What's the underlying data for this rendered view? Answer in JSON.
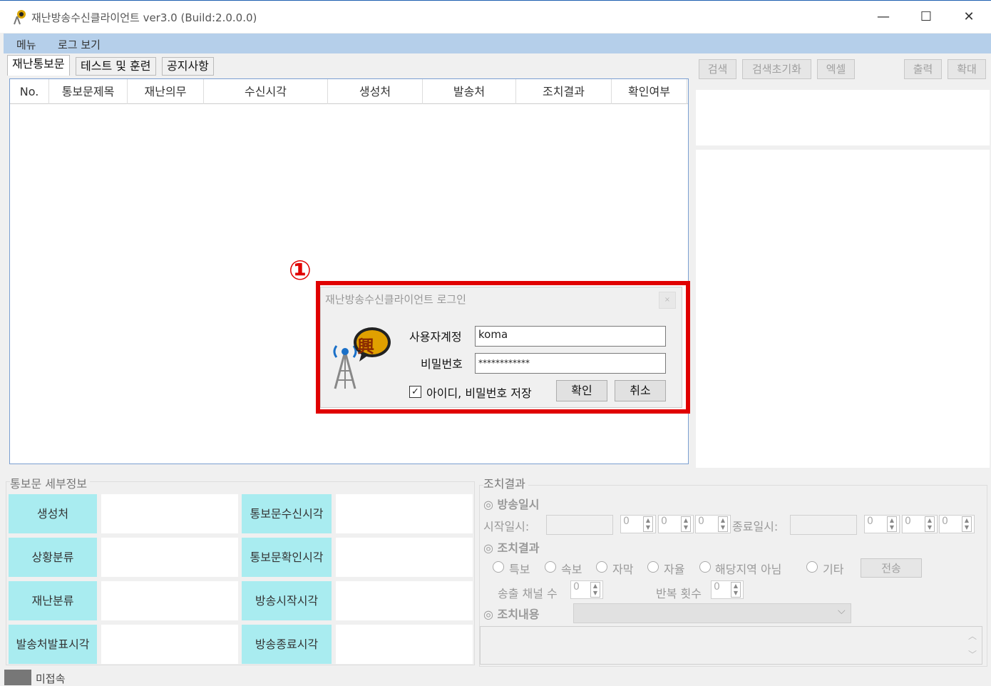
{
  "window": {
    "title": "재난방송수신클라이언트 ver3.0 (Build:2.0.0.0)",
    "minimize": "—",
    "maximize": "☐",
    "close": "✕"
  },
  "menu": {
    "items": [
      "메뉴",
      "로그 보기"
    ]
  },
  "tabs": [
    "재난통보문",
    "테스트 및 훈련",
    "공지사항"
  ],
  "grid": {
    "columns": [
      "No.",
      "통보문제목",
      "재난의무",
      "수신시각",
      "생성처",
      "발송처",
      "조치결과",
      "확인여부"
    ]
  },
  "toolbar": {
    "search": "검색",
    "reset": "검색초기화",
    "excel": "엑셀",
    "print": "출력",
    "zoom": "확대"
  },
  "annotation": {
    "marker": "①"
  },
  "login": {
    "title": "재난방송수신클라이언트 로그인",
    "close": "×",
    "user_label": "사용자계정",
    "user_value": "koma",
    "password_label": "비밀번호",
    "password_value": "************",
    "save_checkbox_mark": "✓",
    "save_label": "아이디, 비밀번호 저장",
    "ok": "확인",
    "cancel": "취소",
    "logo_text": "興"
  },
  "details": {
    "section_title": "통보문 세부정보",
    "fields": [
      "생성처",
      "상황분류",
      "재난분류",
      "발송처발표시각"
    ],
    "fields_right": [
      "통보문수신시각",
      "통보문확인시각",
      "방송시작시각",
      "방송종료시각"
    ]
  },
  "action": {
    "section_title": "조치결과",
    "broadcast_time": "◎ 방송일시",
    "start_label": "시작일시:",
    "end_label": "종료일시:",
    "spin_value": "0",
    "result_title": "◎ 조치결과",
    "options": [
      "특보",
      "속보",
      "자막",
      "자율",
      "해당지역 아님",
      "기타"
    ],
    "send": "전송",
    "channels_label": "송출 채널 수",
    "repeat_label": "반복 횟수",
    "content_title": "◎ 조치내용",
    "dropdown_arrow": "⌵",
    "scroll_up": "︿",
    "scroll_down": "﹀"
  },
  "status": {
    "text": "미접속",
    "color": "#777777"
  }
}
